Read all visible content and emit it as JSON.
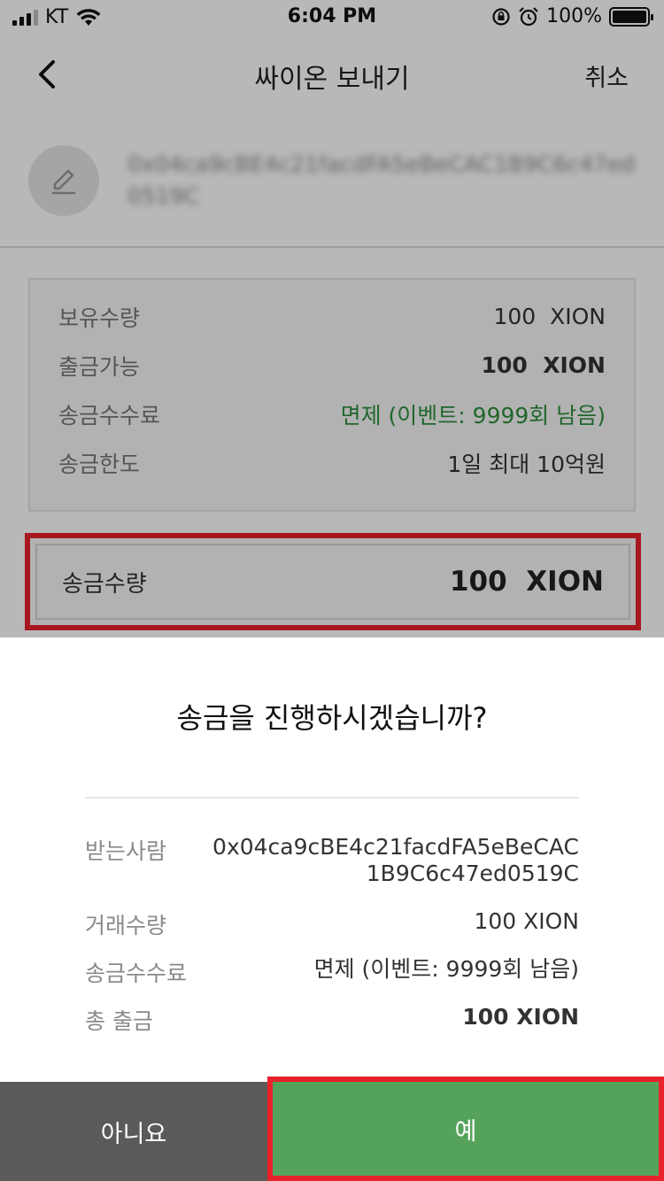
{
  "status_bar": {
    "carrier": "KT",
    "time": "6:04 PM",
    "battery": "100%"
  },
  "nav": {
    "title": "싸이온 보내기",
    "cancel_label": "취소"
  },
  "recipient": {
    "address": "0x04ca9cBE4c21facdFA5eBeCAC1B9C6c47ed0519C"
  },
  "info": {
    "rows": [
      {
        "label": "보유수량",
        "value": "100  XION"
      },
      {
        "label": "출금가능",
        "value": "100  XION"
      },
      {
        "label": "송금수수료",
        "value": "면제 (이벤트: 9999회 남음)"
      },
      {
        "label": "송금한도",
        "value": "1일 최대 10억원"
      }
    ]
  },
  "send_amount": {
    "label": "송금수량",
    "value": "100  XION"
  },
  "dialog": {
    "title": "송금을 진행하시겠습니까?",
    "recipient_label": "받는사람",
    "recipient_line1": "0x04ca9cBE4c21facdFA5eBeCAC",
    "recipient_line2": "1B9C6c47ed0519C",
    "amount_label": "거래수량",
    "amount_value": "100 XION",
    "fee_label": "송금수수료",
    "fee_value": "면제 (이벤트: 9999회 남음)",
    "total_label": "총 출금",
    "total_value": "100 XION",
    "no_label": "아니요",
    "yes_label": "예"
  },
  "colors": {
    "accent_green": "#55a35b",
    "fee_green": "#2f8f3f",
    "highlight_red": "#e8222a",
    "no_button": "#5a5a5a"
  }
}
